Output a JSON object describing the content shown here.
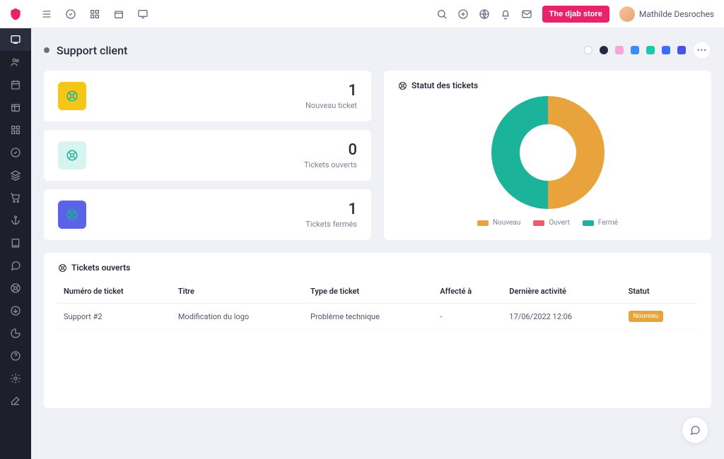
{
  "header": {
    "store_button": "The djab store",
    "user_name": "Mathilde Desroches"
  },
  "page": {
    "title": "Support client"
  },
  "swatches": [
    {
      "color": "#ffffff",
      "circle": true,
      "outlined": true
    },
    {
      "color": "#2a2a3c",
      "circle": true
    },
    {
      "color": "#f5a8d8"
    },
    {
      "color": "#3d8bff"
    },
    {
      "color": "#1cc7b0"
    },
    {
      "color": "#3d6cff"
    },
    {
      "color": "#4a52e0"
    }
  ],
  "stats": [
    {
      "value": "1",
      "label": "Nouveau ticket",
      "icon_bg": "#f5c518",
      "icon_color": "#1cb39b"
    },
    {
      "value": "0",
      "label": "Tickets ouverts",
      "icon_bg": "#d6f5f0",
      "icon_color": "#1cb39b"
    },
    {
      "value": "1",
      "label": "Tickets fermés",
      "icon_bg": "#5b63e6",
      "icon_color": "#1cb39b"
    }
  ],
  "chart": {
    "title": "Statut des tickets",
    "legend": [
      {
        "label": "Nouveau",
        "color": "#e8a33d"
      },
      {
        "label": "Ouvert",
        "color": "#ef5b6e"
      },
      {
        "label": "Fermé",
        "color": "#1cb39b"
      }
    ]
  },
  "chart_data": {
    "type": "pie",
    "title": "Statut des tickets",
    "categories": [
      "Nouveau",
      "Ouvert",
      "Fermé"
    ],
    "values": [
      1,
      0,
      1
    ],
    "colors": [
      "#e8a33d",
      "#ef5b6e",
      "#1cb39b"
    ]
  },
  "table": {
    "title": "Tickets ouverts",
    "columns": [
      "Numéro de ticket",
      "Titre",
      "Type de ticket",
      "Affecté à",
      "Dernière activité",
      "Statut"
    ],
    "rows": [
      {
        "number": "Support #2",
        "title": "Modification du logo",
        "type": "Problème technique",
        "assigned": "-",
        "activity": "17/06/2022 12:06",
        "status": "Nouveau",
        "status_color": "#e8a33d"
      }
    ]
  }
}
